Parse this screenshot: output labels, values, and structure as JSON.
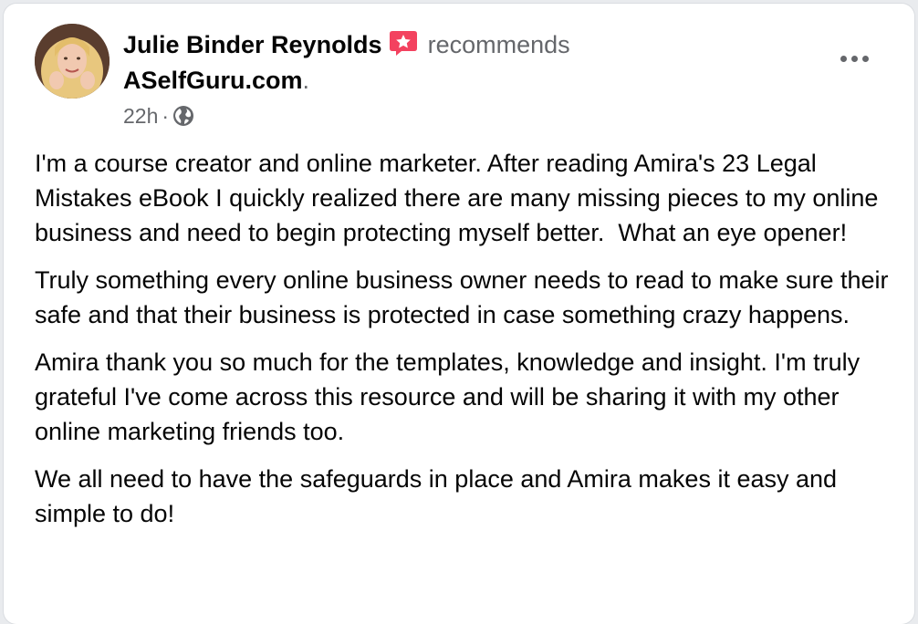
{
  "post": {
    "author": "Julie Binder Reynolds",
    "action": "recommends",
    "page": "ASelfGuru.com",
    "page_suffix": ".",
    "time": "22h",
    "separator": "·",
    "audience_icon": "globe-icon",
    "recommend_icon": "recommend-star-icon",
    "more_icon": "more-options-icon",
    "paragraphs": [
      "I'm a course creator and online marketer. After reading Amira's 23 Legal Mistakes eBook I quickly realized there are many missing pieces to my online business and need to begin protecting myself better.  What an eye opener!",
      "Truly something every online business owner needs to read to make sure their safe and that their business is protected in case something crazy happens.",
      "Amira thank you so much for the templates, knowledge and insight. I'm truly grateful I've come across this resource and will be sharing it with my other online marketing friends too.",
      "We all need to have the safeguards in place and Amira makes it easy and simple to do!"
    ]
  },
  "colors": {
    "accent_recommend": "#f3425f",
    "secondary_text": "#65676b",
    "primary_text": "#050505"
  }
}
